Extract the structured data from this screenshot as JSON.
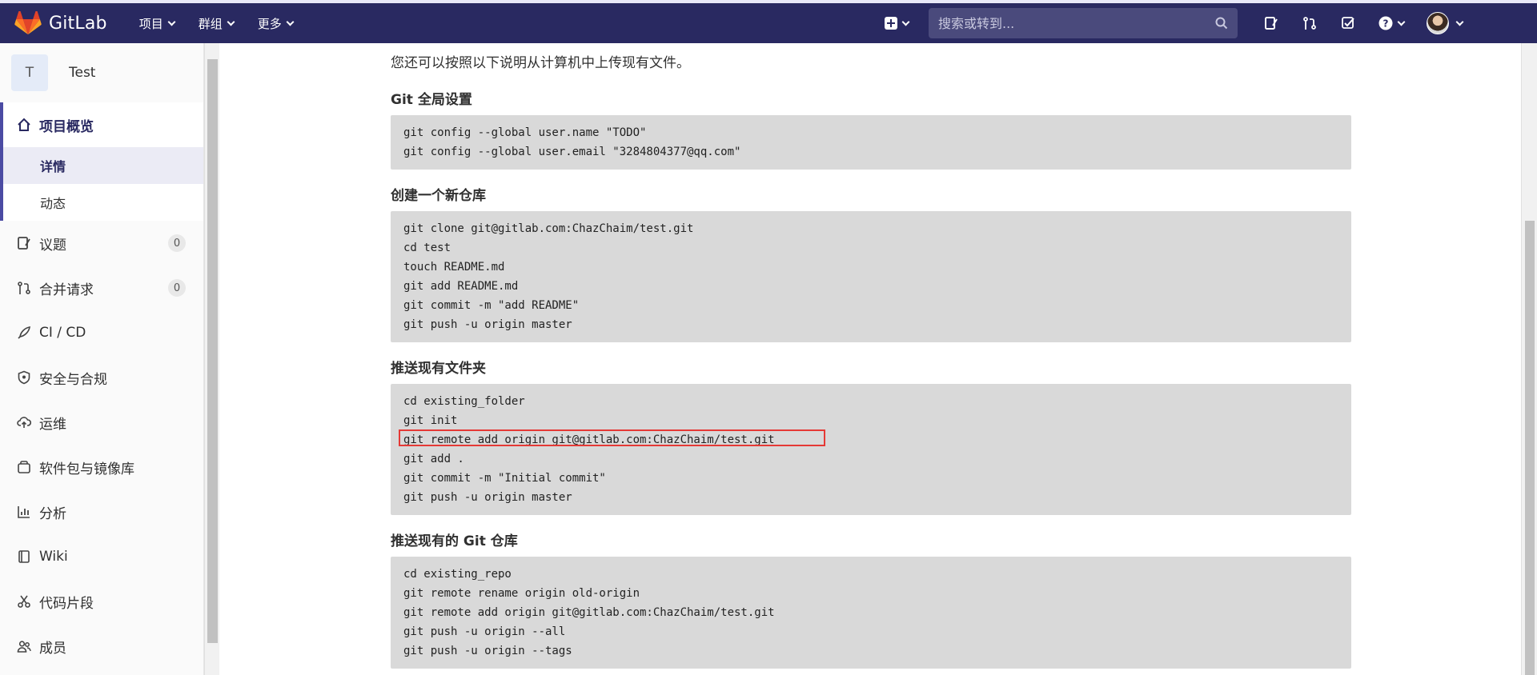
{
  "navbar": {
    "brand": "GitLab",
    "menus": [
      "项目",
      "群组",
      "更多"
    ],
    "search_placeholder": "搜索或转到..."
  },
  "sidebar": {
    "project_initial": "T",
    "project_name": "Test",
    "overview_label": "项目概览",
    "overview_subitems": [
      "详情",
      "动态"
    ],
    "items": [
      {
        "label": "议题",
        "icon": "issues-icon",
        "count": "0"
      },
      {
        "label": "合并请求",
        "icon": "merge-request-icon",
        "count": "0"
      },
      {
        "label": "CI / CD",
        "icon": "rocket-icon"
      },
      {
        "label": "安全与合规",
        "icon": "shield-icon"
      },
      {
        "label": "运维",
        "icon": "cloud-icon"
      },
      {
        "label": "软件包与镜像库",
        "icon": "package-icon"
      },
      {
        "label": "分析",
        "icon": "chart-icon"
      },
      {
        "label": "Wiki",
        "icon": "book-icon"
      },
      {
        "label": "代码片段",
        "icon": "scissors-icon"
      },
      {
        "label": "成员",
        "icon": "users-icon"
      }
    ]
  },
  "main": {
    "intro": "您还可以按照以下说明从计算机中上传现有文件。",
    "sections": [
      {
        "title": "Git 全局设置",
        "lines": [
          "git config --global user.name \"TODO\"",
          "git config --global user.email \"3284804377@qq.com\""
        ]
      },
      {
        "title": "创建一个新仓库",
        "lines": [
          "git clone git@gitlab.com:ChazChaim/test.git",
          "cd test",
          "touch README.md",
          "git add README.md",
          "git commit -m \"add README\"",
          "git push -u origin master"
        ]
      },
      {
        "title": "推送现有文件夹",
        "lines": [
          "cd existing_folder",
          "git init",
          "git remote add origin git@gitlab.com:ChazChaim/test.git",
          "git add .",
          "git commit -m \"Initial commit\"",
          "git push -u origin master"
        ]
      },
      {
        "title": "推送现有的 Git 仓库",
        "lines": [
          "cd existing_repo",
          "git remote rename origin old-origin",
          "git remote add origin git@gitlab.com:ChazChaim/test.git",
          "git push -u origin --all",
          "git push -u origin --tags"
        ]
      }
    ]
  },
  "colors": {
    "navbar": "#292961",
    "sidebar_active": "#4b4ba3",
    "highlight_box": "#e53935",
    "code_bg": "#d9d9d9"
  }
}
